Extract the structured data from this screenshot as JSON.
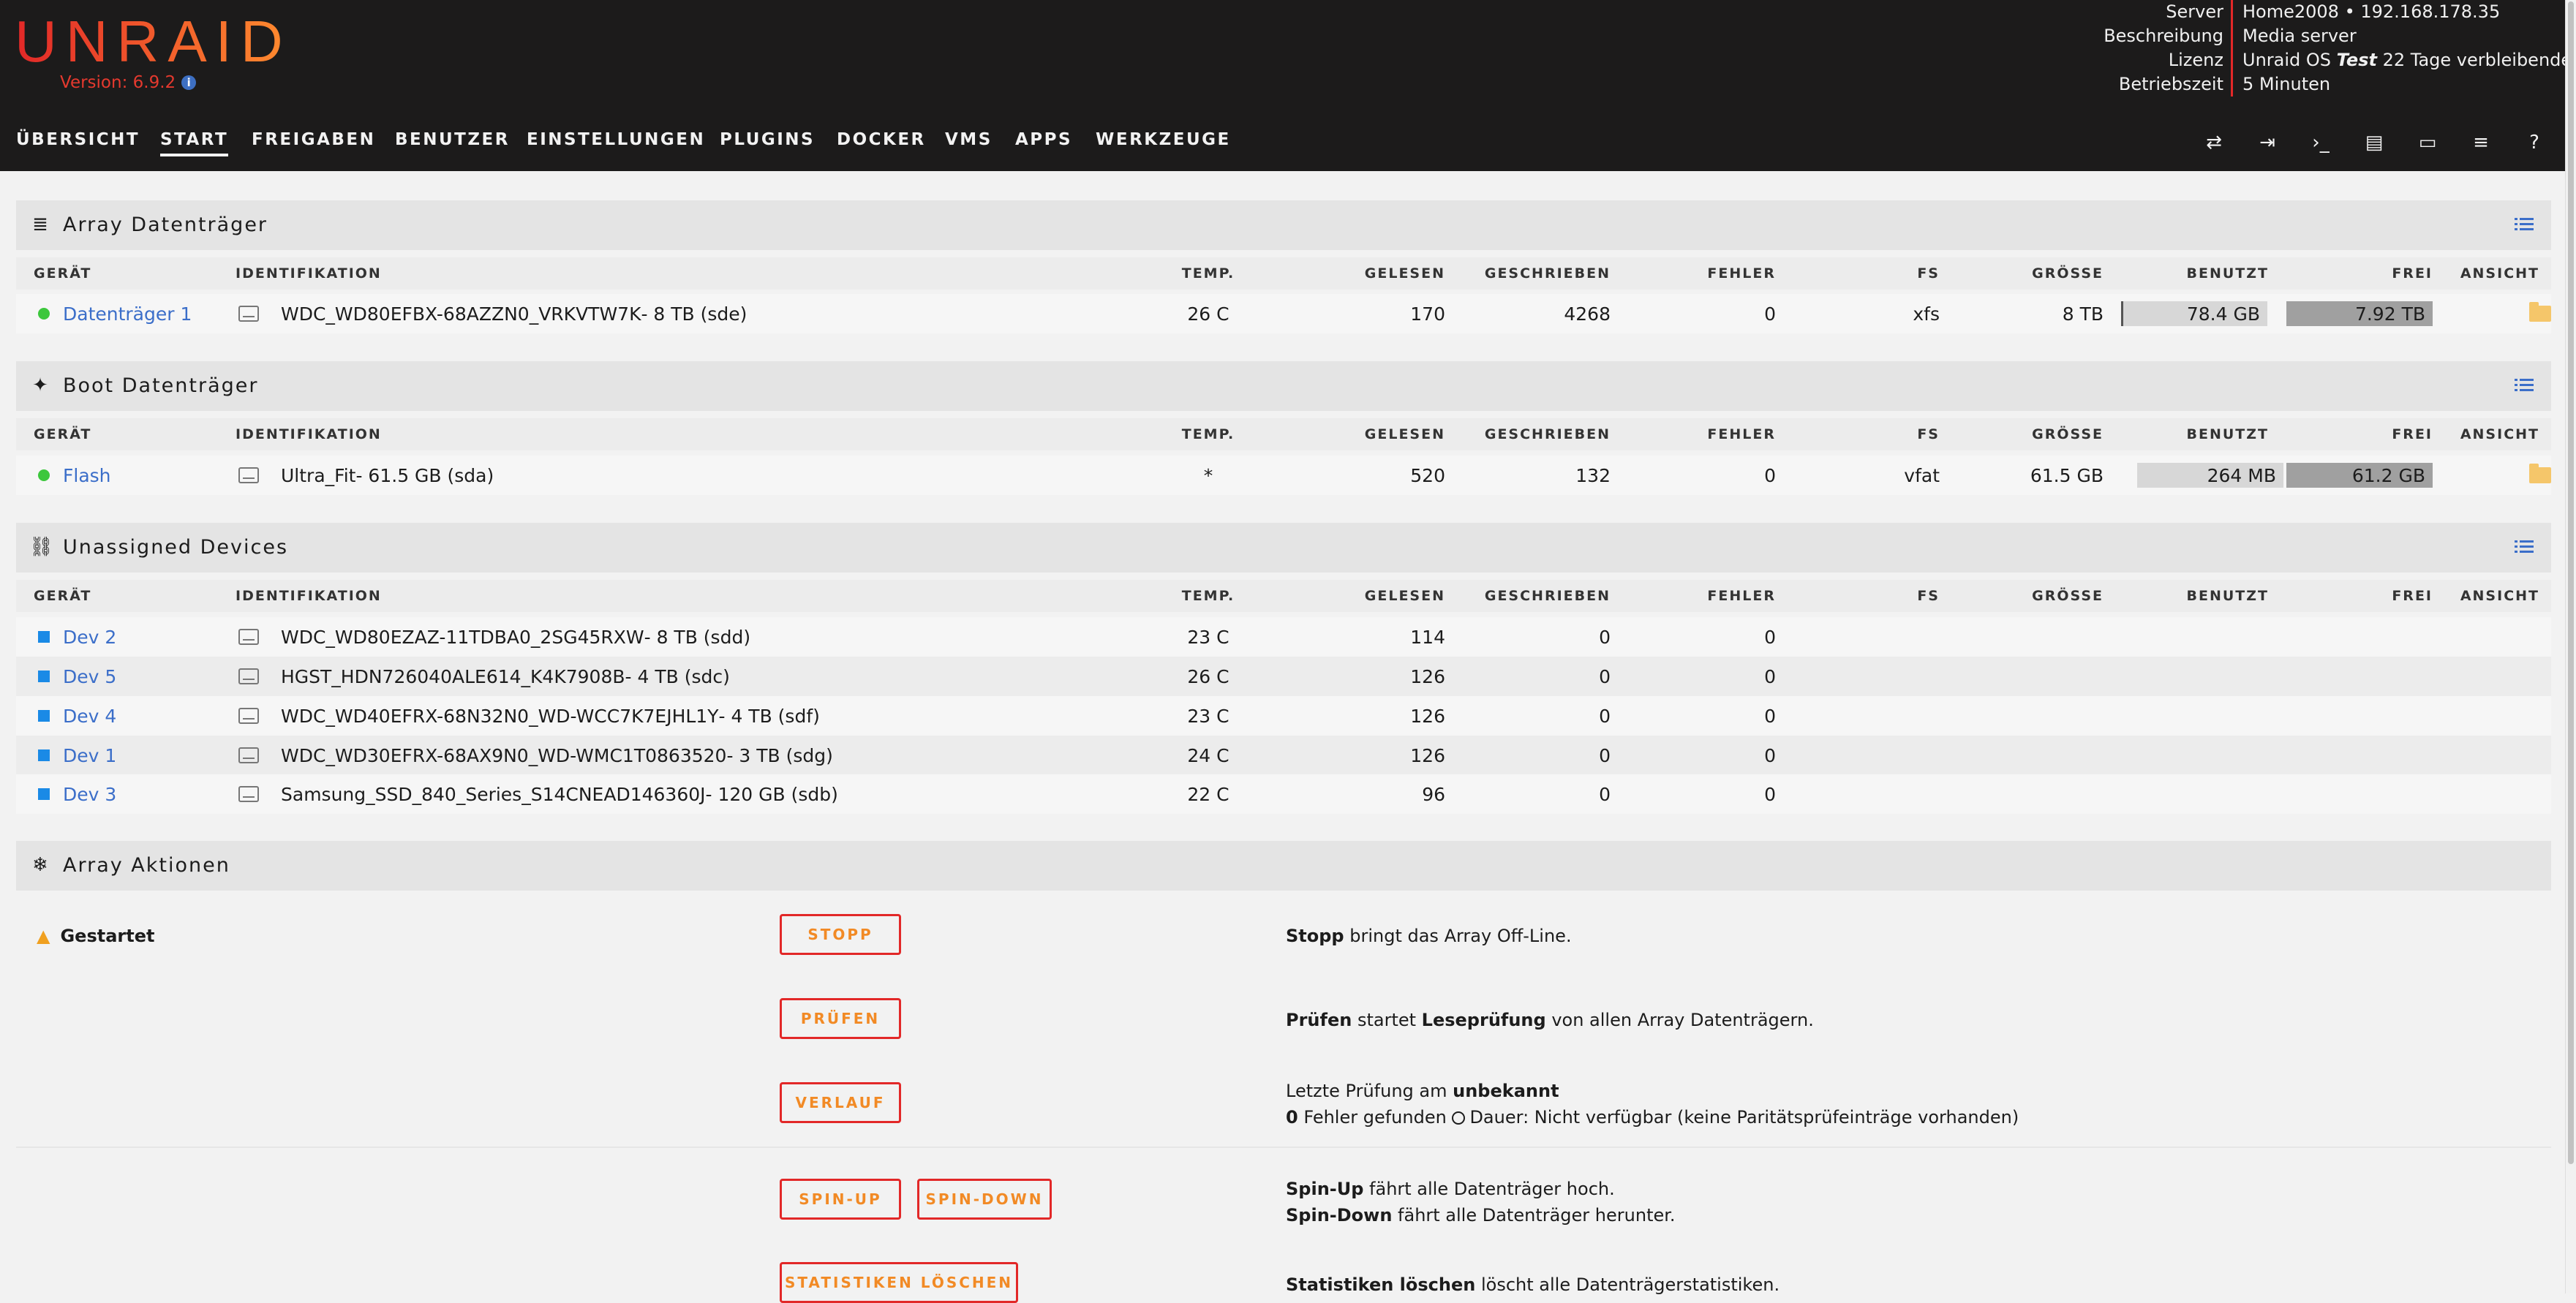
{
  "header": {
    "logo": "UNRAID",
    "version_label": "Version: 6.9.2",
    "server_info": [
      {
        "label": "Server",
        "value": "Home2008 • 192.168.178.35"
      },
      {
        "label": "Beschreibung",
        "value": "Media server"
      },
      {
        "label": "Lizenz",
        "value_prefix": "Unraid OS ",
        "value_em": "Test",
        "value_suffix": " 22 Tage verbleibende"
      },
      {
        "label": "Betriebszeit",
        "value": "5 Minuten"
      }
    ],
    "nav": [
      "ÜBERSICHT",
      "START",
      "FREIGABEN",
      "BENUTZER",
      "EINSTELLUNGEN",
      "PLUGINS",
      "DOCKER",
      "VMS",
      "APPS",
      "WERKZEUGE"
    ],
    "active_nav": "START",
    "accent_colors": [
      "#e22828",
      "#ff8c2f"
    ]
  },
  "columns": [
    "GERÄT",
    "IDENTIFIKATION",
    "TEMP.",
    "GELESEN",
    "GESCHRIEBEN",
    "FEHLER",
    "FS",
    "GRÖSSE",
    "BENUTZT",
    "FREI",
    "ANSICHT"
  ],
  "array": {
    "title": "Array Datenträger",
    "rows": [
      {
        "device": "Datenträger 1",
        "id": "WDC_WD80EFBX-68AZZN0_VRKVTW7K",
        "id_suffix": " - 8 TB (sde)",
        "temp": "26 C",
        "reads": "170",
        "writes": "4268",
        "errors": "0",
        "fs": "xfs",
        "size": "8 TB",
        "used": "78.4 GB",
        "free": "7.92 TB",
        "status": "green",
        "used_fraction": 0.01
      }
    ]
  },
  "boot": {
    "title": "Boot Datenträger",
    "rows": [
      {
        "device": "Flash",
        "id": "Ultra_Fit",
        "id_suffix": " - 61.5 GB (sda)",
        "temp": "*",
        "reads": "520",
        "writes": "132",
        "errors": "0",
        "fs": "vfat",
        "size": "61.5 GB",
        "used": "264 MB",
        "free": "61.2 GB",
        "status": "green",
        "used_fraction": 0.004
      }
    ]
  },
  "unassigned": {
    "title": "Unassigned Devices",
    "rows": [
      {
        "device": "Dev 2",
        "id": "WDC_WD80EZAZ-11TDBA0_2SG45RXW",
        "id_suffix": " - 8 TB (sdd)",
        "temp": "23 C",
        "reads": "114",
        "writes": "0",
        "errors": "0"
      },
      {
        "device": "Dev 5",
        "id": "HGST_HDN726040ALE614_K4K7908B",
        "id_suffix": " - 4 TB (sdc)",
        "temp": "26 C",
        "reads": "126",
        "writes": "0",
        "errors": "0"
      },
      {
        "device": "Dev 4",
        "id": "WDC_WD40EFRX-68N32N0_WD-WCC7K7EJHL1Y",
        "id_suffix": " - 4 TB (sdf)",
        "temp": "23 C",
        "reads": "126",
        "writes": "0",
        "errors": "0"
      },
      {
        "device": "Dev 1",
        "id": "WDC_WD30EFRX-68AX9N0_WD-WMC1T0863520",
        "id_suffix": " - 3 TB (sdg)",
        "temp": "24 C",
        "reads": "126",
        "writes": "0",
        "errors": "0"
      },
      {
        "device": "Dev 3",
        "id": "Samsung_SSD_840_Series_S14CNEAD146360J",
        "id_suffix": " - 120 GB (sdb)",
        "temp": "22 C",
        "reads": "96",
        "writes": "0",
        "errors": "0"
      }
    ]
  },
  "actions": {
    "title": "Array Aktionen",
    "status": "Gestartet",
    "buttons": {
      "stop": "STOPP",
      "check": "PRÜFEN",
      "history": "VERLAUF",
      "spin_up": "SPIN-UP",
      "spin_down": "SPIN-DOWN",
      "clear_stats": "STATISTIKEN LÖSCHEN"
    },
    "texts": {
      "stop_b": "Stopp",
      "stop_rest": " bringt das Array Off-Line.",
      "check_b": "Prüfen",
      "check_mid": " startet ",
      "check_b2": "Leseprüfung",
      "check_rest": " von allen Array Datenträgern.",
      "history_1a": "Letzte Prüfung am ",
      "history_1b": "unbekannt",
      "history_2a": "0",
      "history_2b": " Fehler gefunden  ",
      "history_2c": "Dauer: Nicht verfügbar (keine Paritätsprüfeinträge vorhanden)",
      "spinup_b": "Spin-Up",
      "spinup_rest": " fährt alle Datenträger hoch.",
      "spindown_b": "Spin-Down",
      "spindown_rest": " fährt alle Datenträger herunter.",
      "clear_b": "Statistiken löschen",
      "clear_rest": " löscht alle Datenträgerstatistiken."
    }
  }
}
